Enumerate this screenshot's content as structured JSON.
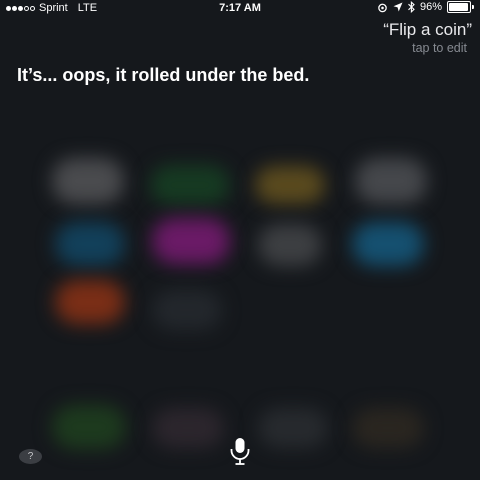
{
  "status_bar": {
    "carrier": "Sprint",
    "network": "LTE",
    "time": "7:17 AM",
    "battery_percent": "96%",
    "battery_level": 0.96,
    "signal_bars": 3,
    "signal_total": 5,
    "icons": [
      "alarm-icon",
      "location-arrow-icon",
      "bluetooth-icon"
    ]
  },
  "siri": {
    "query": "“Flip a coin”",
    "tap_to_edit": "tap to edit",
    "response": "It’s... oops, it rolled under the bed."
  },
  "controls": {
    "help_label": "?",
    "mic_icon": "microphone-icon"
  },
  "colors": {
    "background": "#15181c",
    "secondary_text": "#868a91"
  }
}
